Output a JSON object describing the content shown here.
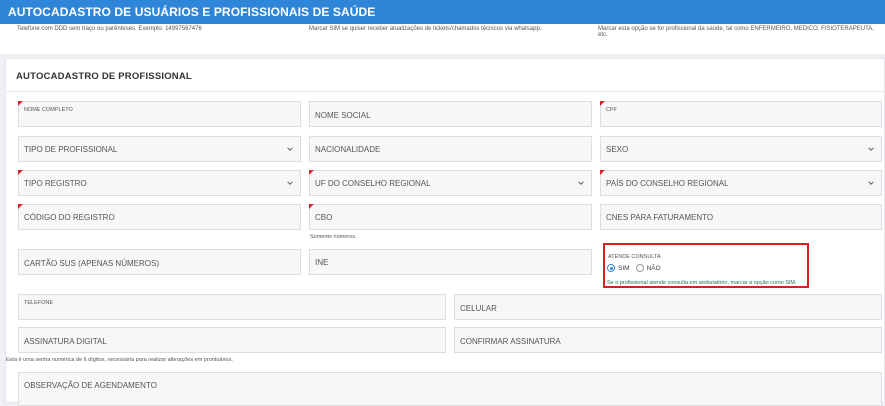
{
  "header": {
    "title": "AUTOCADASTRO DE USUÁRIOS E PROFISSIONAIS DE SAÚDE"
  },
  "hints": {
    "phone": "Telefone com DDD sem traço ou parênteses. Exemplo: 14997567476",
    "whatsapp": "Marcar SIM se quiser receber atualizações de tickets/chamados técnicos via whatsapp.",
    "profissional": "Marcar esta opção se for profissional da saúde, tal como ENFERMEIRO, MEDICO, FISIOTERAPEUTA, etc."
  },
  "section": {
    "title": "AUTOCADASTRO DE PROFISSIONAL"
  },
  "fields": {
    "nome_completo": "NOME COMPLETO",
    "nome_social": "NOME SOCIAL",
    "cpf": "CPF",
    "tipo_profissional": "TIPO DE PROFISSIONAL",
    "nacionalidade": "NACIONALIDADE",
    "sexo": "SEXO",
    "tipo_registro": "TIPO REGISTRO",
    "uf_conselho": "UF DO CONSELHO REGIONAL",
    "pais_conselho": "PAÍS DO CONSELHO REGIONAL",
    "codigo_registro": "CÓDIGO DO REGISTRO",
    "cbo": "CBO",
    "cnes": "CNES PARA FATURAMENTO",
    "cartao_sus": "CARTÃO SUS (APENAS NÚMEROS)",
    "ine": "INE",
    "telefone": "TELEFONE",
    "celular": "CELULAR",
    "assinatura": "ASSINATURA DIGITAL",
    "confirmar_assinatura": "CONFIRMAR ASSINATURA",
    "observacao": "OBSERVAÇÃO DE AGENDAMENTO"
  },
  "help": {
    "cbo": "Somente números.",
    "assinatura": "Esta é uma senha numérica de 6 dígitos, necessária para realizar alterações em prontuários."
  },
  "atende_consulta": {
    "label": "ATENDE CONSULTA",
    "options": [
      "SIM",
      "NÃO"
    ],
    "selected": "SIM",
    "help": "Se o profissional atende consulta em ambulatório, marcar a opção como SIM.",
    "highlight_color": "#d91e1e"
  },
  "colors": {
    "accent": "#2f86d8",
    "required_marker": "#d9262b"
  }
}
